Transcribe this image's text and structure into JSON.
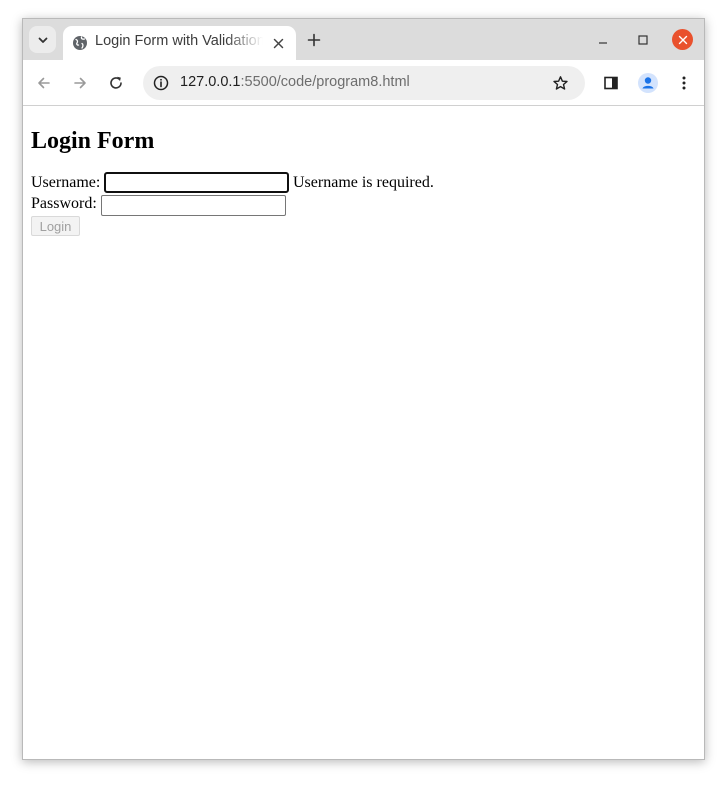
{
  "browser": {
    "tab": {
      "title": "Login Form with Validation",
      "favicon": "globe-icon"
    },
    "window_controls": [
      "minimize-icon",
      "maximize-icon",
      "close-icon"
    ],
    "address_bar": {
      "host": "127.0.0.1",
      "rest": ":5500/code/program8.html"
    },
    "colors": {
      "close_button": "#e9512d",
      "profile_accent": "#1a73e8"
    }
  },
  "page": {
    "heading": "Login Form",
    "username_label": "Username:",
    "username_value": "",
    "username_error": "Username is required.",
    "password_label": "Password:",
    "password_value": "",
    "login_button": "Login",
    "login_button_disabled": true
  }
}
